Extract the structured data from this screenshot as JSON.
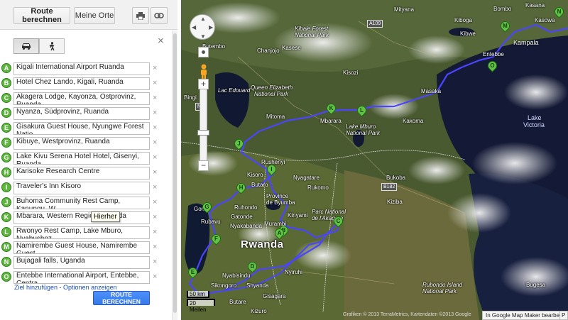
{
  "toolbar": {
    "route_button": "Route berechnen",
    "places_button": "Meine Orte",
    "print_icon": "printer-icon",
    "link_icon": "link-icon"
  },
  "modes": {
    "car_icon": "car-icon",
    "walk_icon": "pedestrian-icon"
  },
  "waypoints": [
    {
      "letter": "A",
      "value": "Kigali International Airport Ruanda"
    },
    {
      "letter": "B",
      "value": "Hotel Chez Lando, Kigali, Ruanda"
    },
    {
      "letter": "C",
      "value": "Akagera Lodge, Kayonza, Ostprovinz, Ruanda"
    },
    {
      "letter": "D",
      "value": "Nyanza, Südprovinz, Ruanda"
    },
    {
      "letter": "E",
      "value": "Gisakura Guest House, Nyungwe Forest Natio"
    },
    {
      "letter": "F",
      "value": "Kibuye, Westprovinz, Ruanda"
    },
    {
      "letter": "G",
      "value": "Lake Kivu Serena Hotel Hotel, Gisenyi, Ruanda"
    },
    {
      "letter": "H",
      "value": "Karisoke Research Centre"
    },
    {
      "letter": "I",
      "value": "Traveler's Inn Kisoro"
    },
    {
      "letter": "J",
      "value": "Buhoma Community Rest Camp, Kanungu, W"
    },
    {
      "letter": "K",
      "value": "Mbarara, Western Region, Uganda"
    },
    {
      "letter": "L",
      "value": "Rwonyo Rest Camp, Lake Mburo, Nyabushoz"
    },
    {
      "letter": "M",
      "value": "Namirembe Guest House, Namirembe Guest"
    },
    {
      "letter": "N",
      "value": "Bujagali falls, Uganda"
    },
    {
      "letter": "O",
      "value": "Entebbe International Airport, Entebbe, Centra"
    }
  ],
  "remove_glyph": "×",
  "close_glyph": "×",
  "tooltip": "Hierher",
  "links": {
    "add_destination": "Ziel hinzufügen",
    "separator": " - ",
    "options": "Optionen anzeigen"
  },
  "calc_button": "ROUTE BERECHNEN",
  "map": {
    "labels": {
      "butembo": "Butembo",
      "kasese": "Kasese",
      "kibale": "Kibale Forest",
      "kibale2": "National Park",
      "chanjojo": "Chanjojo",
      "bingi": "Bingi",
      "lac_edouard": "Lac Edouard",
      "qe": "Queen Elizabeth",
      "qe2": "National Park",
      "mitoma": "Mitoma",
      "mbarara": "Mbarara",
      "mburo": "Lake Mburo",
      "mburo2": "National Park",
      "masaka": "Masaka",
      "kakoma": "Kakoma",
      "kampala": "Kampala",
      "entebbe": "Entebbe",
      "kasowa": "Kasowa",
      "bombo": "Bombo",
      "kiboga": "Kiboga",
      "kibwe": "Kibwe",
      "kasana": "Kasana",
      "kiboga2": "Mityana",
      "kisozi": "Kisozi",
      "lake_victoria": "Lake",
      "lake_victoria2": "Victoria",
      "rushenyi": "Rushenyi",
      "nyagatare": "Nyagatare",
      "rukomo": "Rukomo",
      "kisoro": "Kisoro",
      "butaro": "Butaro",
      "province": "Province",
      "province2": "de Byumba",
      "bukoba": "Bukoba",
      "goma": "Goma",
      "rubavu": "Rubavu",
      "ruhondo": "Ruhondo",
      "gatonde": "Gatonde",
      "nyakabanda": "Nyakabanda",
      "kiny": "Kinyami",
      "murambi": "Murambi",
      "parc": "Parc National",
      "parc2": "de l'Akagera",
      "rwanda": "Rwanda",
      "nyabisindu": "Nyabisindu",
      "sikongoro": "Sikongoro",
      "shyanda": "Shyanda",
      "butare": "Butare",
      "gisagara": "Gisagara",
      "kizuro": "Kizuro",
      "nyiruhi": "Nyiruhi",
      "rubondo": "Rubondo Island",
      "rubondo2": "National Park",
      "bugesa": "Bugesa",
      "kiziba": "Kiziba"
    },
    "shields": {
      "a109": "A109",
      "b182": "B182",
      "n2": "N2"
    },
    "pin_letters": [
      "A",
      "B",
      "C",
      "D",
      "E",
      "F",
      "G",
      "H",
      "I",
      "J",
      "K",
      "L",
      "M",
      "N",
      "O"
    ],
    "scale": {
      "km": "50 km",
      "mi": "20 Meilen"
    },
    "attribution": "Grafiken © 2013 TerraMetrics, Kartendaten ©2013 Google",
    "mymaps": "In Google Map Maker bearbeiten",
    "mymaps_short": "P"
  },
  "colors": {
    "route": "#4b45ff",
    "pin": "#62c245",
    "calc_button": "#4d90fe"
  }
}
